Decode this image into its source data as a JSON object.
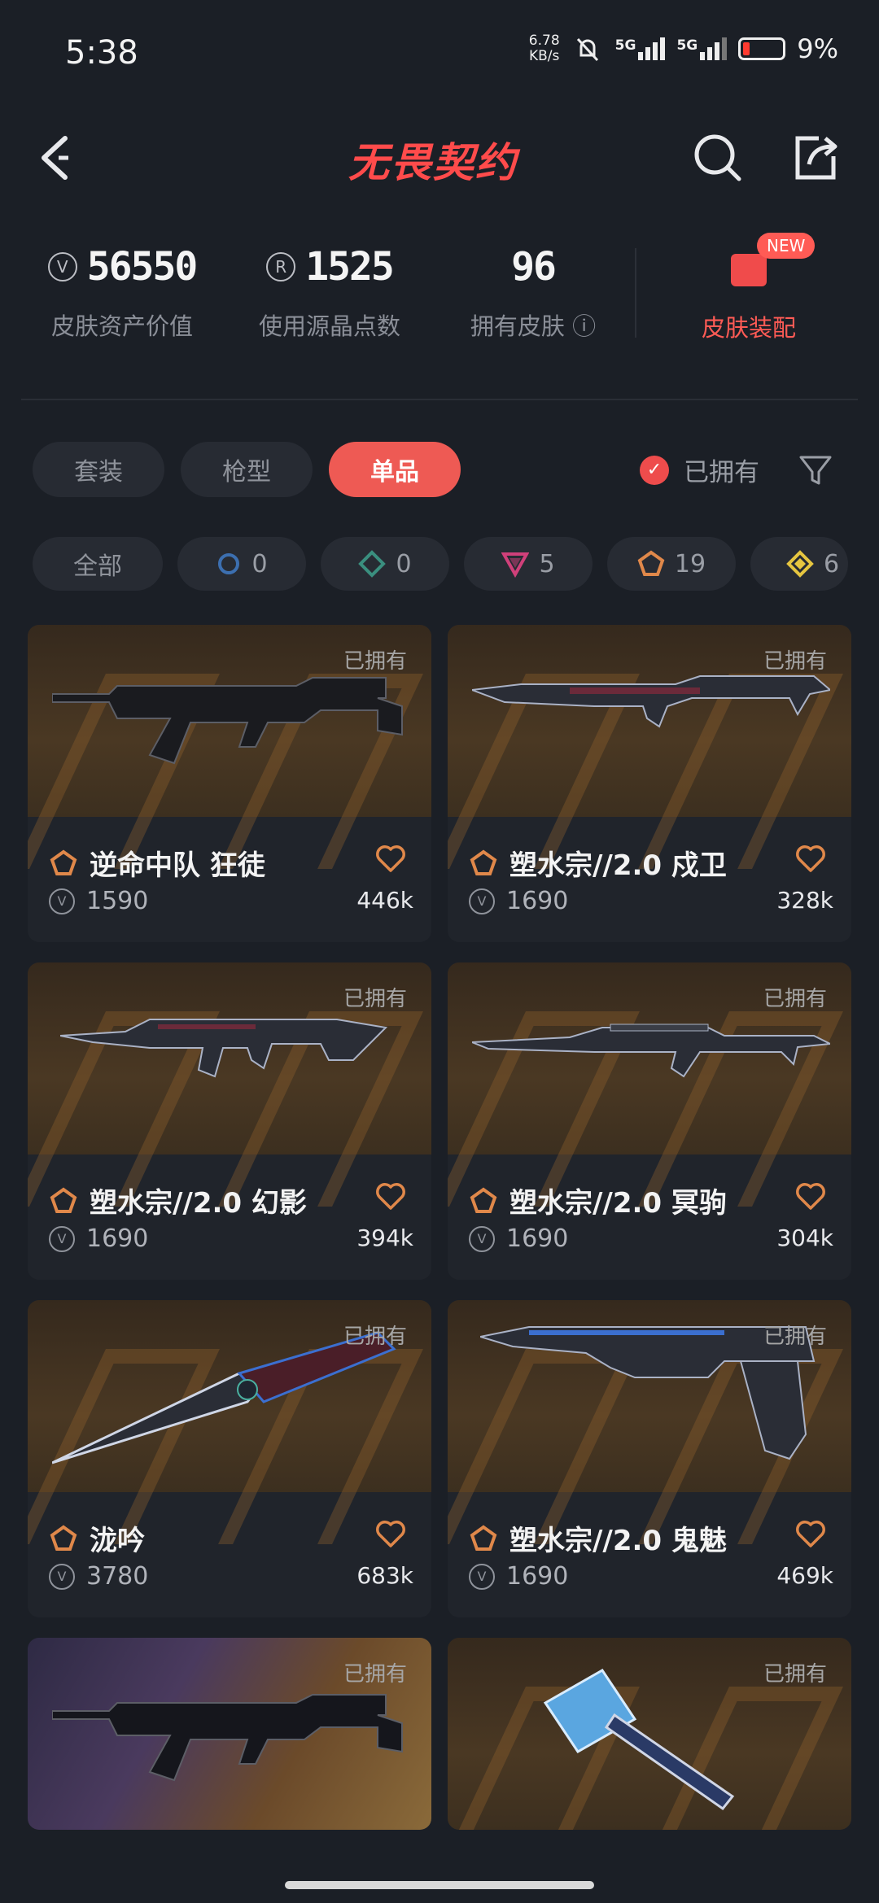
{
  "status_bar": {
    "time": "5:38",
    "speed": "6.78",
    "speed_unit": "KB/s",
    "net1": "5G",
    "net2": "5G",
    "battery": "9%"
  },
  "header": {
    "logo": "无畏契约"
  },
  "stats": [
    {
      "value": "56550",
      "label": "皮肤资产价值",
      "coin": "V"
    },
    {
      "value": "1525",
      "label": "使用源晶点数",
      "coin": "R"
    },
    {
      "value": "96",
      "label": "拥有皮肤 ⓘ",
      "coin": ""
    }
  ],
  "equip": {
    "label": "皮肤装配",
    "badge": "NEW"
  },
  "tabs": [
    {
      "label": "套装",
      "active": false
    },
    {
      "label": "枪型",
      "active": false
    },
    {
      "label": "单品",
      "active": true
    }
  ],
  "owned_filter": {
    "label": "已拥有",
    "checked": true
  },
  "rarity_chips": [
    {
      "label": "全部",
      "count": "",
      "color": ""
    },
    {
      "label": "",
      "count": "0",
      "color": "#3c6fb0"
    },
    {
      "label": "",
      "count": "0",
      "color": "#3a8f7f"
    },
    {
      "label": "",
      "count": "5",
      "color": "#d0407a"
    },
    {
      "label": "",
      "count": "19",
      "color": "#e0884a"
    },
    {
      "label": "",
      "count": "6",
      "color": "#e6c640"
    }
  ],
  "cards": [
    {
      "name": "逆命中队 狂徒",
      "price": "1590",
      "likes": "446k",
      "owned": "已拥有"
    },
    {
      "name": "塑水宗//2.0 戍卫",
      "price": "1690",
      "likes": "328k",
      "owned": "已拥有"
    },
    {
      "name": "塑水宗//2.0 幻影",
      "price": "1690",
      "likes": "394k",
      "owned": "已拥有"
    },
    {
      "name": "塑水宗//2.0 冥驹",
      "price": "1690",
      "likes": "304k",
      "owned": "已拥有"
    },
    {
      "name": "泷吟",
      "price": "3780",
      "likes": "683k",
      "owned": "已拥有"
    },
    {
      "name": "塑水宗//2.0 鬼魅",
      "price": "1690",
      "likes": "469k",
      "owned": "已拥有"
    },
    {
      "name": "",
      "price": "",
      "likes": "",
      "owned": "已拥有"
    },
    {
      "name": "",
      "price": "",
      "likes": "",
      "owned": "已拥有"
    }
  ]
}
